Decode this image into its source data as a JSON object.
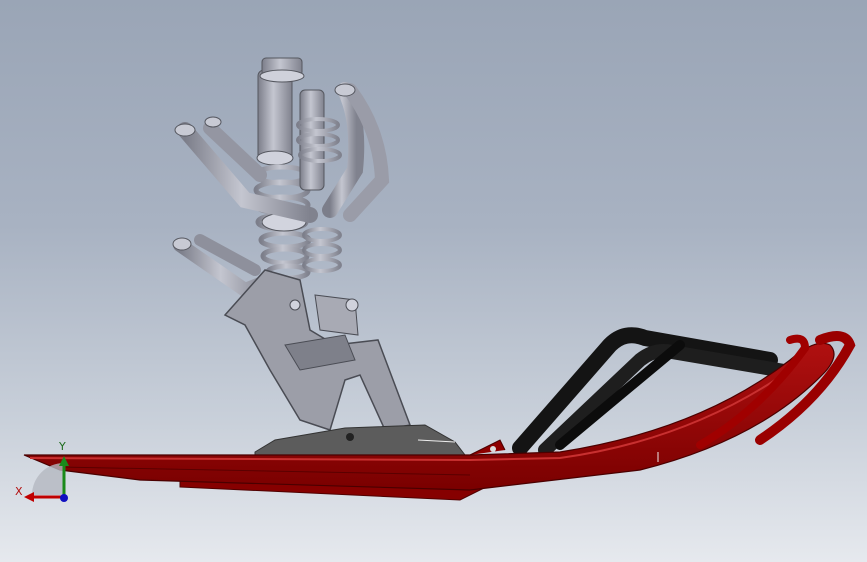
{
  "viewport": {
    "background_top": "#9aa5b6",
    "background_bottom": "#e6e9ee"
  },
  "model": {
    "ski_color": "#8e0000",
    "ski_highlight": "#c01818",
    "frame_color": "#8a8c98",
    "frame_light": "#b8bac6",
    "shock_color": "#a0a2ae",
    "base_color": "#5a5a5a",
    "loop_color": "#111111"
  },
  "triad": {
    "x_label": "X",
    "y_label": "Y",
    "x_color": "#c00000",
    "y_color": "#1a8a1a",
    "z_color": "#1010c0"
  }
}
